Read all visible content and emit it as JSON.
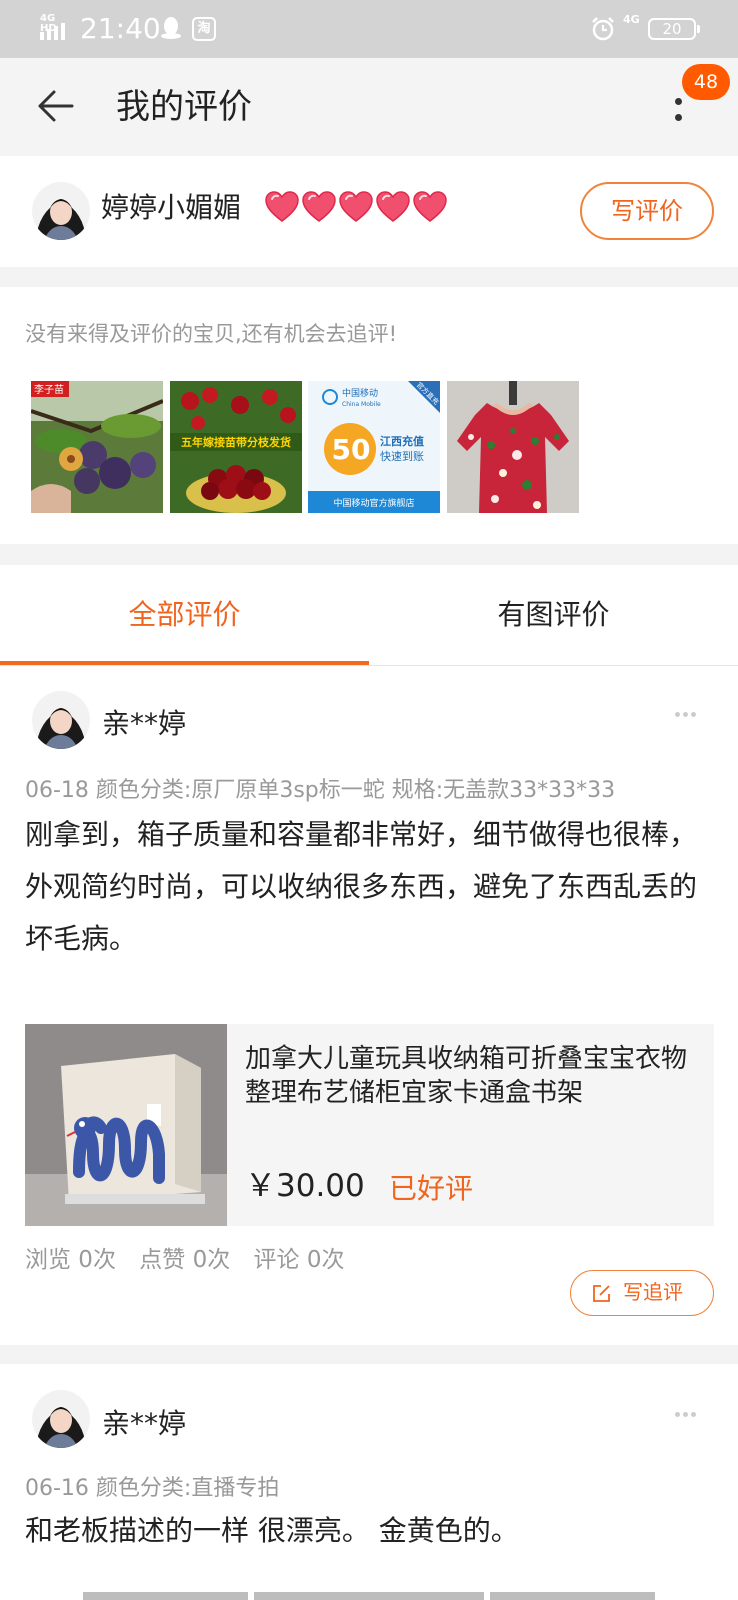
{
  "status_bar": {
    "network": "4G HD",
    "time": "21:40",
    "taobao_icon_text": "淘",
    "network_right": "4G",
    "battery": "20",
    "icons": [
      "signal-icon",
      "qq-icon",
      "taobao-icon",
      "alarm-icon",
      "battery-icon"
    ]
  },
  "header": {
    "title": "我的评价",
    "message_count": "48",
    "icons": [
      "back-arrow-icon",
      "more-icon"
    ]
  },
  "profile": {
    "username": "婷婷小媚媚",
    "hearts": 5,
    "write_review_label": "写评价"
  },
  "pending": {
    "tip": "没有来得及评价的宝贝,还有机会去追评!",
    "thumb1_tag": "李子苗",
    "thumb2_caption": "五年嫁接苗带分枝发货",
    "thumb3": {
      "brand": "中国移动",
      "brand_en": "China Mobile",
      "corner": "官方直充",
      "amount": "50",
      "line1": "江西充值",
      "line2": "快速到账",
      "footer": "中国移动官方旗舰店"
    }
  },
  "tabs": [
    {
      "label": "全部评价",
      "active": true
    },
    {
      "label": "有图评价",
      "active": false
    }
  ],
  "reviews": [
    {
      "username": "亲**婷",
      "meta": "06-18  颜色分类:原厂原单3sp标一蛇 规格:无盖款33*33*33",
      "text": "刚拿到，箱子质量和容量都非常好，细节做得也很棒，外观简约时尚，可以收纳很多东西，避免了东西乱丢的坏毛病。",
      "product": {
        "title": "加拿大儿童玩具收纳箱可折叠宝宝衣物整理布艺储柜宜家卡通盒书架",
        "price": "￥30.00",
        "status": "已好评"
      },
      "stats": {
        "views": "浏览 0次",
        "likes": "点赞 0次",
        "comments": "评论 0次"
      },
      "followup_label": "写追评"
    },
    {
      "username": "亲**婷",
      "meta": "06-16  颜色分类:直播专拍",
      "text": "和老板描述的一样 很漂亮。  金黄色的。"
    }
  ],
  "colors": {
    "accent": "#f0641e",
    "badge": "#ff5a00",
    "heart": "#f0506e",
    "status_bar": "#d3d3d3"
  }
}
